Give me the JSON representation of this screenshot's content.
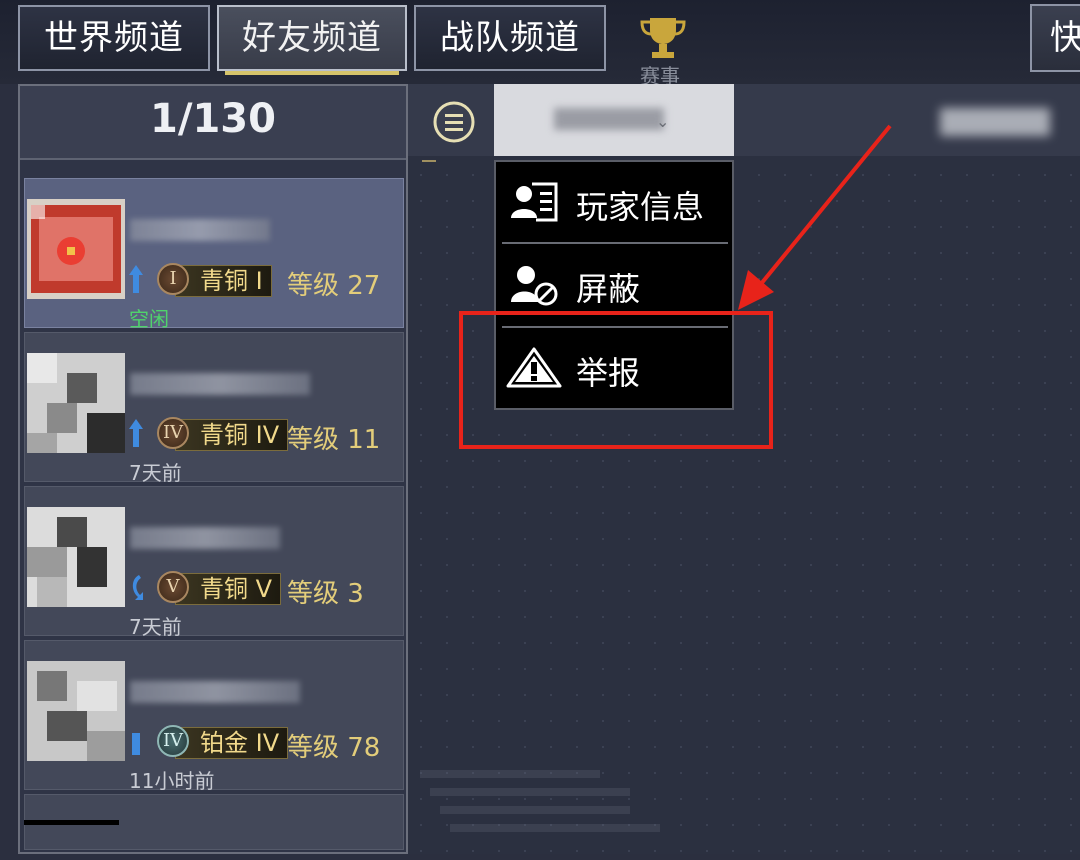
{
  "tabs": [
    {
      "label": "世界频道",
      "active": false
    },
    {
      "label": "好友频道",
      "active": true
    },
    {
      "label": "战队频道",
      "active": false
    }
  ],
  "trophy_label": "赛事",
  "quick_label": "快",
  "friend_count": "1/130",
  "friends": [
    {
      "rank_numeral": "I",
      "rank": "青铜 I",
      "level": "等级 27",
      "status": "空闲",
      "selected": true,
      "online": true
    },
    {
      "rank_numeral": "IV",
      "rank": "青铜 IV",
      "level": "等级 11",
      "status": "7天前",
      "selected": false,
      "online": false
    },
    {
      "rank_numeral": "V",
      "rank": "青铜 V",
      "level": "等级 3",
      "status": "7天前",
      "selected": false,
      "online": false
    },
    {
      "rank_numeral": "IV",
      "rank": "铂金 IV",
      "level": "等级 78",
      "status": "11小时前",
      "selected": false,
      "online": false
    }
  ],
  "menu": {
    "player_info": "玩家信息",
    "block": "屏蔽",
    "report": "举报"
  },
  "colors": {
    "annotation": "#e8231a",
    "online": "#4fd36b",
    "level": "#e3cd7a"
  }
}
